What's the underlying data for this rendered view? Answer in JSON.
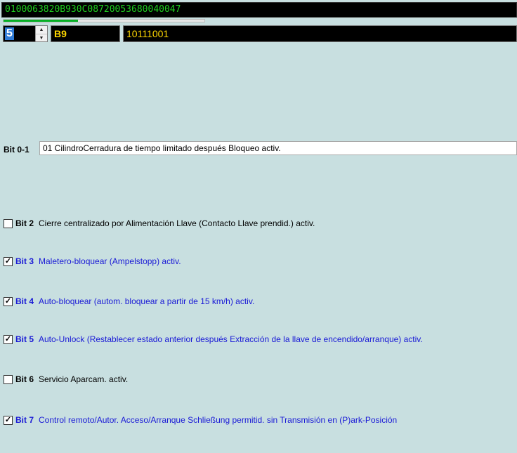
{
  "code": "0100063820B930C08720053680040047",
  "progress_fraction": 0.37,
  "byte_index": "5",
  "hex_value": "B9",
  "binary_value": "10111001",
  "bit01": {
    "label": "Bit 0-1",
    "value": "01 CilindroCerradura de tiempo limitado después Bloqueo activ."
  },
  "bits": [
    {
      "label": "Bit 2",
      "text": "Cierre centralizado por Alimentación Llave (Contacto Llave prendid.) activ.",
      "checked": false
    },
    {
      "label": "Bit 3",
      "text": "Maletero-bloquear (Ampelstopp) activ.",
      "checked": true
    },
    {
      "label": "Bit 4",
      "text": "Auto-bloquear (autom. bloquear a partir de 15 km/h) activ.",
      "checked": true
    },
    {
      "label": "Bit 5",
      "text": "Auto-Unlock (Restablecer estado anterior después Extracción de la llave de encendido/arranque) activ.",
      "checked": true
    },
    {
      "label": "Bit 6",
      "text": "Servicio Aparcam. activ.",
      "checked": false
    },
    {
      "label": "Bit 7",
      "text": "Control remoto/Autor. Acceso/Arranque Schließung permitid. sin Transmisión en (P)ark-Posición",
      "checked": true
    }
  ]
}
